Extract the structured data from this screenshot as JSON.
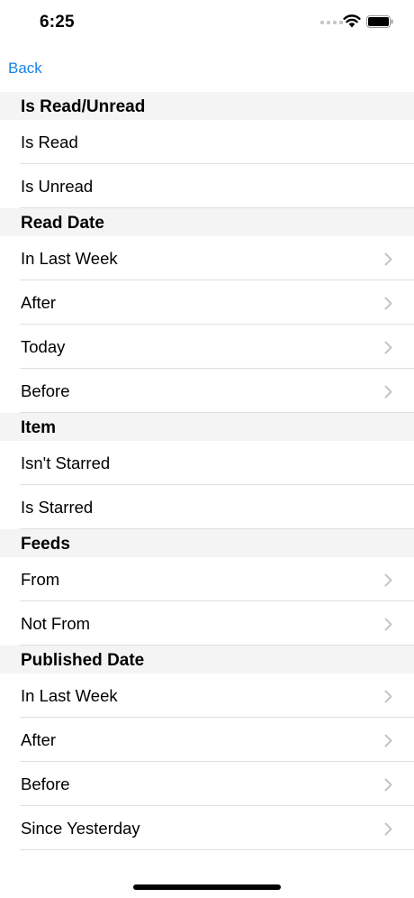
{
  "status": {
    "time": "6:25"
  },
  "nav": {
    "back_label": "Back"
  },
  "sections": [
    {
      "title": "Is Read/Unread",
      "rows": [
        {
          "label": "Is Read",
          "chevron": false
        },
        {
          "label": "Is Unread",
          "chevron": false
        }
      ]
    },
    {
      "title": "Read Date",
      "rows": [
        {
          "label": "In Last Week",
          "chevron": true
        },
        {
          "label": "After",
          "chevron": true
        },
        {
          "label": "Today",
          "chevron": true
        },
        {
          "label": "Before",
          "chevron": true
        }
      ]
    },
    {
      "title": "Item",
      "rows": [
        {
          "label": "Isn't Starred",
          "chevron": false
        },
        {
          "label": "Is Starred",
          "chevron": false
        }
      ]
    },
    {
      "title": "Feeds",
      "rows": [
        {
          "label": "From",
          "chevron": true
        },
        {
          "label": "Not From",
          "chevron": true
        }
      ]
    },
    {
      "title": "Published Date",
      "rows": [
        {
          "label": "In Last Week",
          "chevron": true
        },
        {
          "label": "After",
          "chevron": true
        },
        {
          "label": "Before",
          "chevron": true
        },
        {
          "label": "Since Yesterday",
          "chevron": true
        }
      ]
    }
  ],
  "colors": {
    "accent": "#1a82e6",
    "chevron": "#c4c4c7",
    "section_bg": "#f4f4f5",
    "separator": "#dedee0"
  },
  "icons": {
    "row_disclosure": "chevron-right-icon"
  }
}
